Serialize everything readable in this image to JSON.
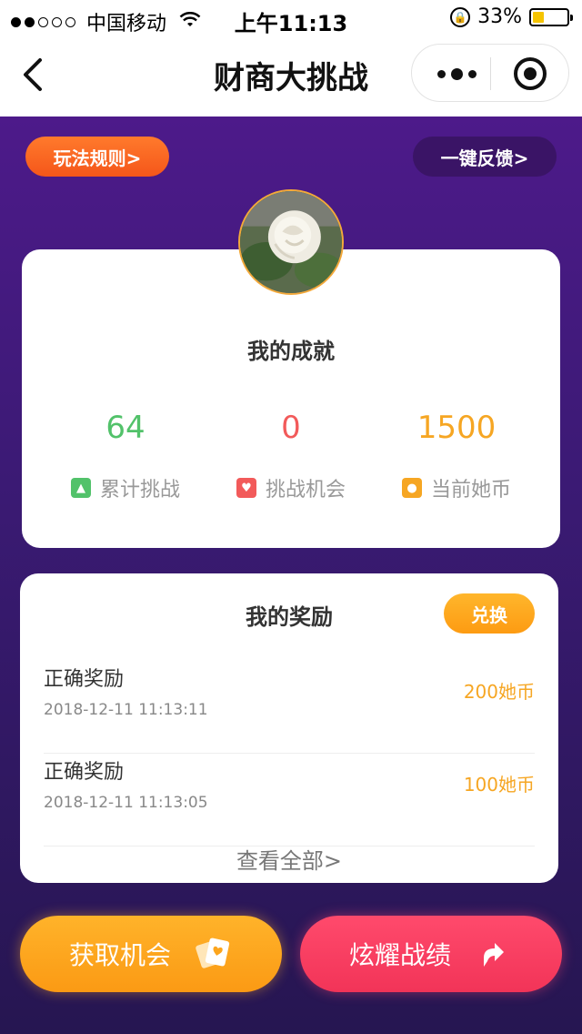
{
  "status_bar": {
    "carrier": "中国移动",
    "time": "上午11:13",
    "battery_text": "33%",
    "battery_level": 0.33,
    "icons": [
      "signal-dots",
      "wifi-icon",
      "rotation-lock-icon",
      "battery-icon"
    ]
  },
  "nav": {
    "title": "财商大挑战",
    "icons": [
      "back-arrow-icon",
      "more-dots-icon",
      "close-target-icon"
    ]
  },
  "top_buttons": {
    "rules": "玩法规则>",
    "feedback": "一键反馈>"
  },
  "avatar": {
    "icon": "rose-photo-avatar"
  },
  "achievements": {
    "title": "我的成就",
    "stats": [
      {
        "value": "64",
        "label": "累计挑战",
        "color": "#52c26a",
        "icon": "triangle-icon"
      },
      {
        "value": "0",
        "label": "挑战机会",
        "color": "#f25a5a",
        "icon": "heart-icon"
      },
      {
        "value": "1500",
        "label": "当前她币",
        "color": "#f6a623",
        "icon": "coin-icon"
      }
    ]
  },
  "rewards": {
    "title": "我的奖励",
    "exchange_label": "兑换",
    "items": [
      {
        "title": "正确奖励",
        "date": "2018-12-11 11:13:11",
        "amount": "200她币"
      },
      {
        "title": "正确奖励",
        "date": "2018-12-11 11:13:05",
        "amount": "100她币"
      }
    ],
    "view_all": "查看全部>"
  },
  "actions": {
    "get_chance": "获取机会",
    "share": "炫耀战绩",
    "colors": {
      "get": "#fca51d",
      "share": "#f53d60"
    }
  }
}
